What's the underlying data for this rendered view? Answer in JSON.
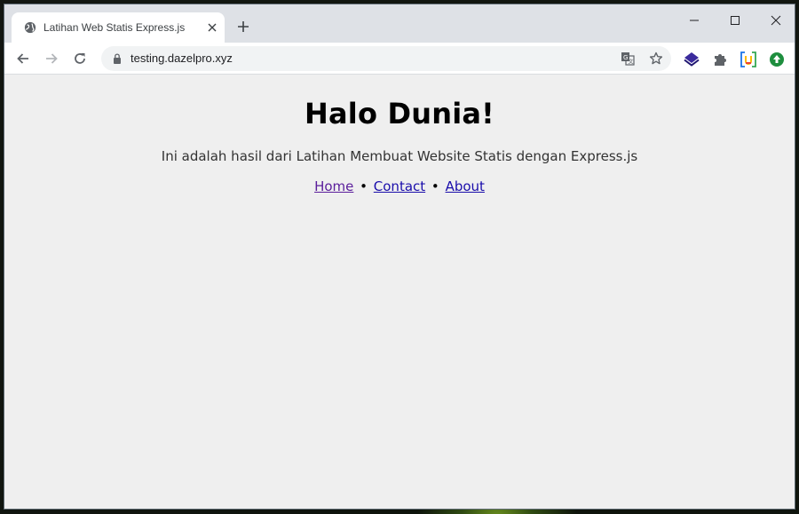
{
  "browser": {
    "tab_title": "Latihan Web Statis Express.js",
    "url": "testing.dazelpro.xyz"
  },
  "page": {
    "heading": "Halo Dunia!",
    "description": "Ini adalah hasil dari Latihan Membuat Website Statis dengan Express.js",
    "nav": {
      "home": "Home",
      "contact": "Contact",
      "about": "About",
      "separator": "•"
    }
  },
  "icons": {
    "tab_favicon": "globe-icon",
    "tab_close": "close-icon",
    "new_tab": "plus-icon",
    "minimize": "minimize-icon",
    "maximize": "maximize-icon",
    "close_window": "close-icon",
    "back": "arrow-left-icon",
    "forward": "arrow-right-icon",
    "reload": "reload-icon",
    "lock": "lock-icon",
    "translate": "translate-icon",
    "bookmark": "star-icon",
    "extensions": [
      "layers-extension-icon",
      "puzzle-icon",
      "bracket-extension-icon",
      "upload-extension-icon"
    ]
  },
  "colors": {
    "page_bg": "#efefef",
    "link": "#1a0dab",
    "visited_link": "#5a1d9b",
    "tabstrip_bg": "#dee1e6"
  }
}
